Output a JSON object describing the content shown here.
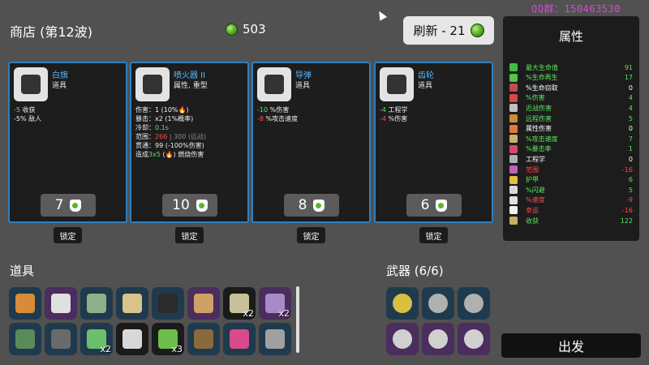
{
  "header": {
    "shop_title": "商店 (第12波)",
    "currency_amount": "503",
    "refresh_label": "刷新 - 21",
    "watermark": "QQ群：150463530"
  },
  "colors": {
    "item_border": "#2f7fbf",
    "item_name": "#56b8ff",
    "positive": "#5ce65c",
    "negative": "#ff4b4b",
    "material": "#5fb52a"
  },
  "shop": {
    "cards": [
      {
        "name": "白旗",
        "type": "道具",
        "icon": "white-flag-icon",
        "price": "7",
        "desc": [
          {
            "parts": [
              {
                "t": "-5",
                "c": "g"
              },
              {
                "t": " 收获",
                "c": ""
              }
            ]
          },
          {
            "parts": [
              {
                "t": "-5% 敌人",
                "c": ""
              }
            ]
          }
        ]
      },
      {
        "name": "喷火器 II",
        "type": "属性, 重型",
        "icon": "flamethrower-icon",
        "price": "10",
        "desc": [
          {
            "parts": [
              {
                "t": "伤害：1 (10%",
                "c": ""
              },
              {
                "t": "🔥",
                "c": "r"
              },
              {
                "t": ")",
                "c": ""
              }
            ]
          },
          {
            "parts": [
              {
                "t": "暴击：x2 (1%概率)",
                "c": ""
              }
            ]
          },
          {
            "parts": [
              {
                "t": "冷却：",
                "c": ""
              },
              {
                "t": "0.1s",
                "c": "g"
              }
            ]
          },
          {
            "parts": [
              {
                "t": "范围：",
                "c": ""
              },
              {
                "t": "266",
                "c": "r"
              },
              {
                "t": " | 300 (远战)",
                "c": "dim"
              }
            ]
          },
          {
            "parts": [
              {
                "t": "贯通：99 (-100%伤害)",
                "c": ""
              }
            ]
          },
          {
            "parts": [
              {
                "t": "造成",
                "c": ""
              },
              {
                "t": "3x5",
                "c": "g"
              },
              {
                "t": " (🔥) 燃烧伤害",
                "c": ""
              }
            ]
          }
        ]
      },
      {
        "name": "导弹",
        "type": "道具",
        "icon": "missile-icon",
        "price": "8",
        "desc": [
          {
            "parts": [
              {
                "t": "-10",
                "c": "g"
              },
              {
                "t": " %伤害",
                "c": ""
              }
            ]
          },
          {
            "parts": [
              {
                "t": "-8",
                "c": "r"
              },
              {
                "t": " %攻击速度",
                "c": ""
              }
            ]
          }
        ]
      },
      {
        "name": "齿轮",
        "type": "道具",
        "icon": "gear-icon",
        "price": "6",
        "desc": [
          {
            "parts": [
              {
                "t": "-4",
                "c": "g"
              },
              {
                "t": " 工程学",
                "c": ""
              }
            ]
          },
          {
            "parts": [
              {
                "t": "-4",
                "c": "r"
              },
              {
                "t": " %伤害",
                "c": ""
              }
            ]
          }
        ]
      }
    ],
    "lock_label": "锁定"
  },
  "stats": {
    "title": "属性",
    "rows": [
      {
        "label": "最大生命值",
        "value": "91",
        "color": "g",
        "icon_color": "#3fbf3f"
      },
      {
        "label": "%生命再生",
        "value": "17",
        "color": "g",
        "icon_color": "#59c14a"
      },
      {
        "label": "%生命窃取",
        "value": "0",
        "color": "",
        "icon_color": "#c24b4b"
      },
      {
        "label": "%伤害",
        "value": "4",
        "color": "g",
        "icon_color": "#d24a4a"
      },
      {
        "label": "近战伤害",
        "value": "4",
        "color": "g",
        "icon_color": "#c0c0c0"
      },
      {
        "label": "远程伤害",
        "value": "5",
        "color": "g",
        "icon_color": "#d18a3a"
      },
      {
        "label": "属性伤害",
        "value": "0",
        "color": "",
        "icon_color": "#e07b3a"
      },
      {
        "label": "%攻击速度",
        "value": "7",
        "color": "g",
        "icon_color": "#c9b36b"
      },
      {
        "label": "%暴击率",
        "value": "1",
        "color": "g",
        "icon_color": "#d64b6b"
      },
      {
        "label": "工程学",
        "value": "0",
        "color": "",
        "icon_color": "#b0b0b0"
      },
      {
        "label": "范围",
        "value": "-16",
        "color": "r",
        "icon_color": "#c060c0"
      },
      {
        "label": "护甲",
        "value": "6",
        "color": "g",
        "icon_color": "#e0c040"
      },
      {
        "label": "%闪避",
        "value": "5",
        "color": "g",
        "icon_color": "#d8d8d8"
      },
      {
        "label": "%速度",
        "value": "-9",
        "color": "r",
        "icon_color": "#e0e0e0"
      },
      {
        "label": "幸运",
        "value": "-16",
        "color": "r",
        "icon_color": "#f0f0f0"
      },
      {
        "label": "收获",
        "value": "122",
        "color": "g",
        "icon_color": "#c8b060"
      }
    ]
  },
  "inventory": {
    "title": "道具",
    "items": [
      {
        "icon": "campfire-icon",
        "variant": "",
        "count": "",
        "glyph": "#d98a3a"
      },
      {
        "icon": "bandage-icon",
        "variant": "purple",
        "count": "",
        "glyph": "#e0e0e0"
      },
      {
        "icon": "ammo-belt-icon",
        "variant": "",
        "count": "",
        "glyph": "#8fb08a"
      },
      {
        "icon": "amulet-icon",
        "variant": "",
        "count": "",
        "glyph": "#d8c38a"
      },
      {
        "icon": "stone-icon",
        "variant": "",
        "count": "",
        "glyph": "#2b2b2b"
      },
      {
        "icon": "wheat-icon",
        "variant": "purple",
        "count": "",
        "glyph": "#d1a064"
      },
      {
        "icon": "treasure-map-icon",
        "variant": "dark",
        "count": "x2",
        "glyph": "#c8c09a"
      },
      {
        "icon": "alien-eyes-icon",
        "variant": "purple",
        "count": "x2",
        "glyph": "#a88ac8"
      },
      {
        "icon": "turret-icon",
        "variant": "",
        "count": "",
        "glyph": "#5a8a5a"
      },
      {
        "icon": "wheelbarrow-icon",
        "variant": "",
        "count": "",
        "glyph": "#6a6a6a"
      },
      {
        "icon": "cactus-icon",
        "variant": "",
        "count": "x2",
        "glyph": "#6cbf6c"
      },
      {
        "icon": "coffee-cup-icon",
        "variant": "dark",
        "count": "",
        "glyph": "#d8d8d8"
      },
      {
        "icon": "tree-icon",
        "variant": "dark",
        "count": "x3",
        "glyph": "#6cbf4a"
      },
      {
        "icon": "dung-icon",
        "variant": "",
        "count": "",
        "glyph": "#8a6a3a"
      },
      {
        "icon": "syringe-icon",
        "variant": "",
        "count": "",
        "glyph": "#d84a8a"
      },
      {
        "icon": "snail-icon",
        "variant": "",
        "count": "",
        "glyph": "#a0a0a0"
      }
    ]
  },
  "weapons": {
    "title": "武器 (6/6)",
    "items": [
      {
        "icon": "rocket-launcher-icon",
        "variant": "",
        "glyph": "#d8c040"
      },
      {
        "icon": "slingshot-icon",
        "variant": "",
        "glyph": "#b0b0b0"
      },
      {
        "icon": "slingshot-icon",
        "variant": "",
        "glyph": "#b0b0b0"
      },
      {
        "icon": "drill-disc-icon",
        "variant": "purple",
        "glyph": "#d0d0d0"
      },
      {
        "icon": "drill-disc-icon",
        "variant": "purple",
        "glyph": "#d0d0d0"
      },
      {
        "icon": "drill-disc-icon",
        "variant": "purple",
        "glyph": "#d0d0d0"
      }
    ]
  },
  "footer": {
    "go_label": "出发"
  }
}
